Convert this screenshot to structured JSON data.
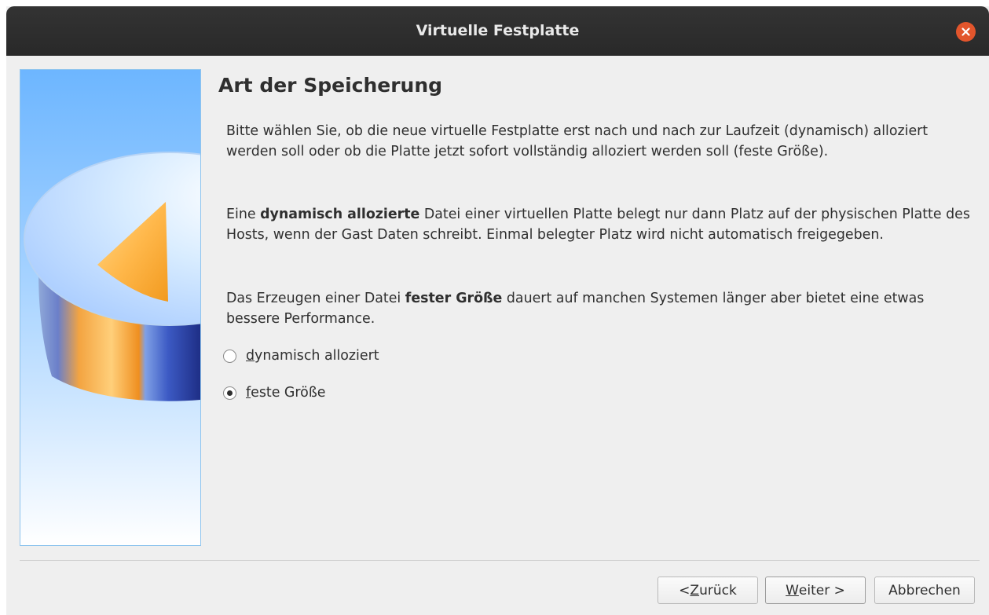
{
  "window": {
    "title": "Virtuelle Festplatte"
  },
  "page": {
    "heading": "Art der Speicherung",
    "paragraph1": "Bitte wählen Sie, ob die neue virtuelle Festplatte erst nach und nach zur Laufzeit (dynamisch) alloziert werden soll oder ob die Platte jetzt sofort vollständig alloziert werden soll (feste Größe).",
    "paragraph2": {
      "before": "Eine ",
      "bold": "dynamisch allozierte",
      "after": " Datei einer virtuellen Platte belegt nur dann Platz auf der physischen Platte des Hosts, wenn der Gast Daten schreibt. Einmal belegter Platz wird nicht automatisch freigegeben."
    },
    "paragraph3": {
      "before": "Das Erzeugen einer Datei ",
      "bold": "fester Größe",
      "after": " dauert auf manchen Systemen länger aber bietet eine etwas bessere Performance."
    }
  },
  "options": {
    "dynamic": {
      "mnemonic": "d",
      "rest": "ynamisch alloziert",
      "checked": false
    },
    "fixed": {
      "mnemonic": "f",
      "rest": "este Größe",
      "checked": true
    }
  },
  "buttons": {
    "back": {
      "prefix": "< ",
      "mnemonic": "Z",
      "rest": "urück"
    },
    "next": {
      "mnemonic": "W",
      "rest": "eiter >"
    },
    "cancel": {
      "label": "Abbrechen"
    }
  },
  "colors": {
    "titlebar": "#2d2d2d",
    "close": "#e2552c",
    "dialog_bg": "#efefef",
    "side_panel_top": "#6db6ff"
  },
  "icons": {
    "close": "close-icon",
    "side": "hard-disk-pie-illustration"
  }
}
